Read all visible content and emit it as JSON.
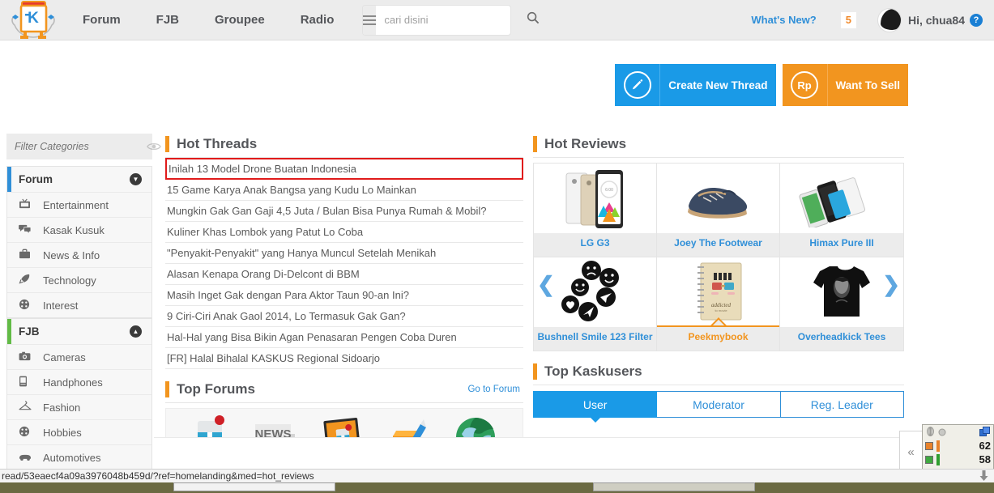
{
  "header": {
    "logo_alt": "kaskus-logo",
    "nav": [
      {
        "label": "Forum"
      },
      {
        "label": "FJB"
      },
      {
        "label": "Groupee"
      },
      {
        "label": "Radio"
      }
    ],
    "search": {
      "placeholder": "cari disini",
      "value": "",
      "icon": "search-icon",
      "menu_icon": "hamburger-icon"
    },
    "whats_new": "What's New?",
    "notification_count": "5",
    "greeting": "Hi, chua84",
    "help_glyph": "?"
  },
  "actions": [
    {
      "label": "Create New Thread",
      "icon": "pencil-icon",
      "color": "#1a9ae7"
    },
    {
      "label": "Want To Sell",
      "icon": "rupiah-icon",
      "color": "#f2951f"
    }
  ],
  "sidebar": {
    "filter_placeholder": "Filter Categories",
    "filter_value": "",
    "eye_icon": "eye-icon",
    "groups": [
      {
        "title": "Forum",
        "accent": "#2f8fd8",
        "collapsed": false,
        "chevron": "▼",
        "items": [
          {
            "label": "Entertainment",
            "icon": "tv-icon",
            "glyph": "📺"
          },
          {
            "label": "Kasak Kusuk",
            "icon": "chat-icon",
            "glyph": "💬"
          },
          {
            "label": "News & Info",
            "icon": "briefcase-icon",
            "glyph": "💼"
          },
          {
            "label": "Technology",
            "icon": "rocket-icon",
            "glyph": "🚀"
          },
          {
            "label": "Interest",
            "icon": "palette-icon",
            "glyph": "🎨"
          }
        ]
      },
      {
        "title": "FJB",
        "accent": "#62bb46",
        "collapsed": false,
        "chevron": "▲",
        "items": [
          {
            "label": "Cameras",
            "icon": "camera-icon",
            "glyph": "📷"
          },
          {
            "label": "Handphones",
            "icon": "phone-icon",
            "glyph": "📱"
          },
          {
            "label": "Fashion",
            "icon": "hanger-icon",
            "glyph": "☂"
          },
          {
            "label": "Hobbies",
            "icon": "palette-icon",
            "glyph": "🎨"
          },
          {
            "label": "Automotives",
            "icon": "car-icon",
            "glyph": "🚗"
          }
        ]
      }
    ]
  },
  "hot_threads": {
    "title": "Hot Threads",
    "items": [
      {
        "title": "Inilah 13 Model Drone Buatan Indonesia",
        "highlighted": true
      },
      {
        "title": "15 Game Karya Anak Bangsa yang Kudu Lo Mainkan",
        "highlighted": false
      },
      {
        "title": "Mungkin Gak Gan Gaji 4,5 Juta / Bulan Bisa Punya Rumah & Mobil?",
        "highlighted": false
      },
      {
        "title": "Kuliner Khas Lombok yang Patut Lo Coba",
        "highlighted": false
      },
      {
        "title": "\"Penyakit-Penyakit\" yang Hanya Muncul Setelah Menikah",
        "highlighted": false
      },
      {
        "title": "Alasan Kenapa Orang Di-Delcont di BBM",
        "highlighted": false
      },
      {
        "title": "Masih Inget Gak dengan Para Aktor Taun 90-an Ini?",
        "highlighted": false
      },
      {
        "title": "9 Ciri-Ciri Anak Gaol 2014, Lo Termasuk Gak Gan?",
        "highlighted": false
      },
      {
        "title": "Hal-Hal yang Bisa Bikin Agan Penasaran Pengen Coba Duren",
        "highlighted": false
      },
      {
        "title": "[FR] Halal Bihalal KASKUS Regional Sidoarjo",
        "highlighted": false
      }
    ]
  },
  "hot_reviews": {
    "title": "Hot Reviews",
    "prev_icon": "chevron-left-icon",
    "next_icon": "chevron-right-icon",
    "items": [
      {
        "name": "LG G3",
        "thumb": "phone-lg-g3",
        "active": false
      },
      {
        "name": "Joey The Footwear",
        "thumb": "sneaker-shoe",
        "active": false
      },
      {
        "name": "Himax Pure III",
        "thumb": "phone-himax",
        "active": false
      },
      {
        "name": "Bushnell Smile 123 Filter",
        "thumb": "smiley-badges",
        "active": false
      },
      {
        "name": "Peekmybook",
        "thumb": "notebook",
        "active": true
      },
      {
        "name": "Overheadkick Tees",
        "thumb": "black-tshirt",
        "active": false
      }
    ]
  },
  "top_forums": {
    "title": "Top Forums",
    "go_link": "Go to Forum",
    "tiles": [
      {
        "icon": "thread-icon",
        "label": ""
      },
      {
        "icon": "news-icon",
        "label": "NEWS"
      },
      {
        "icon": "tablet-icon",
        "label": ""
      },
      {
        "icon": "pencil-note-icon",
        "label": ""
      },
      {
        "icon": "globe-icon",
        "label": ""
      }
    ]
  },
  "top_kaskusers": {
    "title": "Top Kaskusers",
    "tabs": [
      {
        "label": "User",
        "active": true
      },
      {
        "label": "Moderator",
        "active": false
      },
      {
        "label": "Reg. Leader",
        "active": false
      }
    ]
  },
  "side_panel": {
    "collapse_icon": "chevron-double-left-icon"
  },
  "network_widget": {
    "upload_value": "62",
    "download_value": "58",
    "cube_icon": "network-cube-icon",
    "globe_icon": "network-globe-icon"
  },
  "status_bar": {
    "url": "read/53eaecf4a09a3976048b459d/?ref=homelanding&med=hot_reviews",
    "scroll_icon": "arrow-down-icon"
  }
}
